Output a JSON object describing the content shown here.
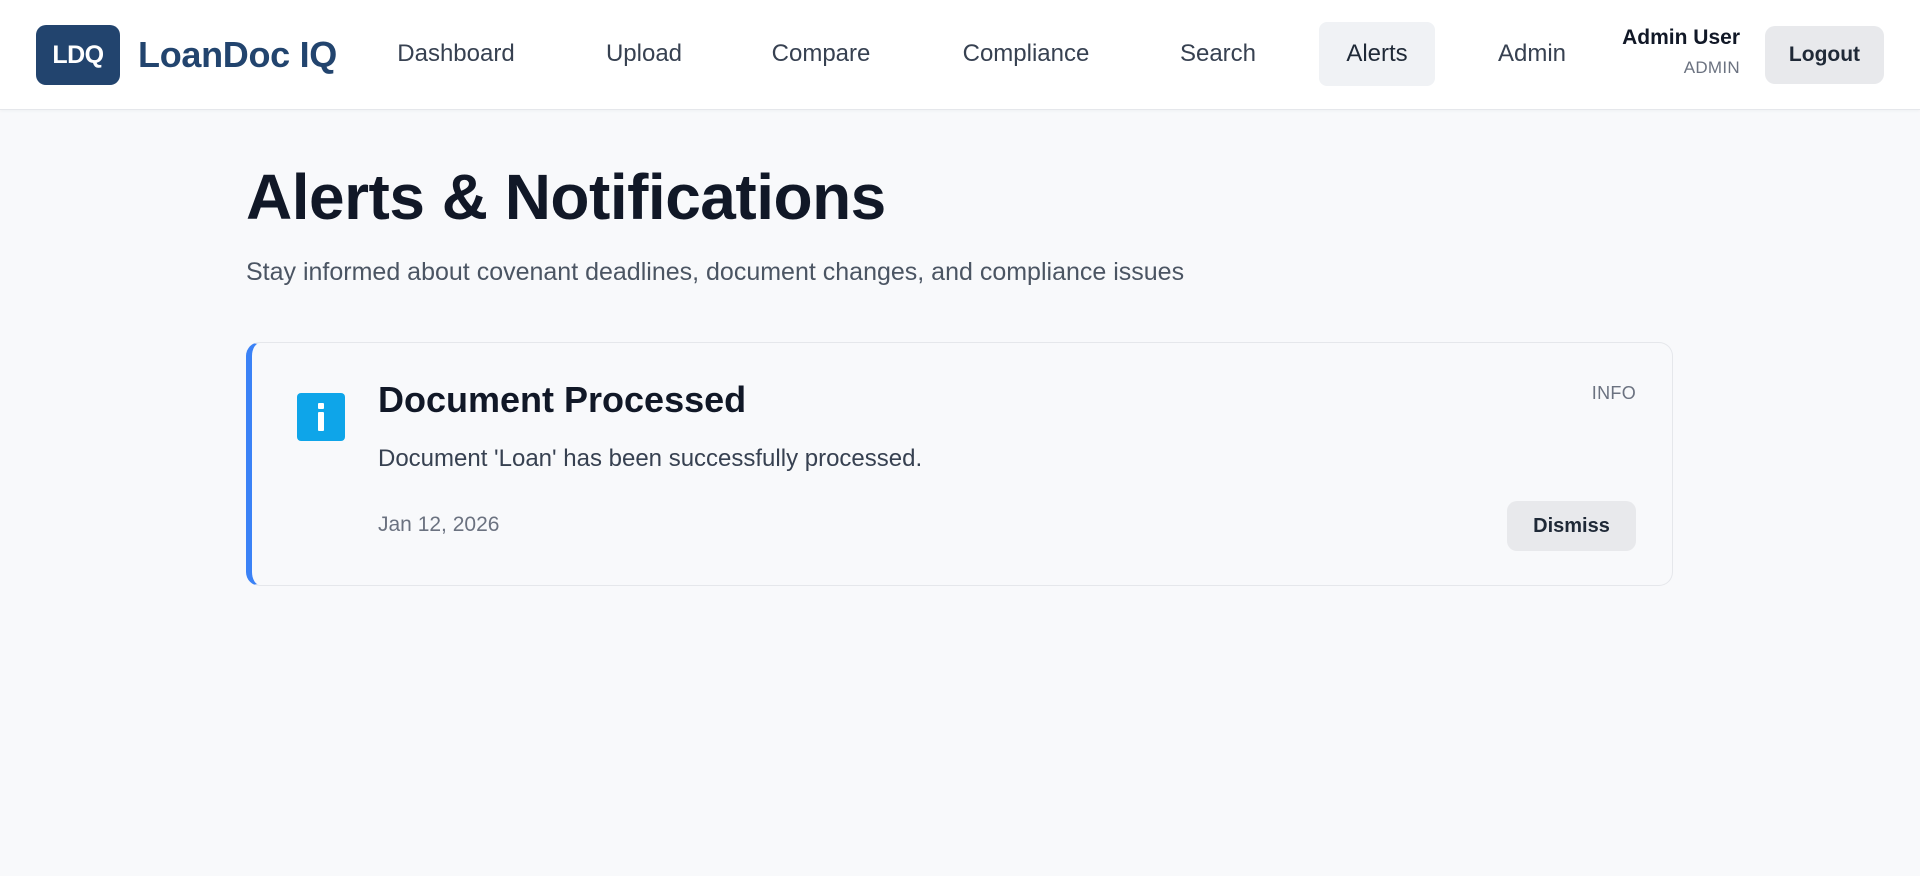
{
  "brand": {
    "logo_text": "LDQ",
    "name": "LoanDoc IQ"
  },
  "nav": {
    "items": [
      {
        "label": "Dashboard",
        "active": false
      },
      {
        "label": "Upload",
        "active": false
      },
      {
        "label": "Compare",
        "active": false
      },
      {
        "label": "Compliance",
        "active": false
      },
      {
        "label": "Search",
        "active": false
      },
      {
        "label": "Alerts",
        "active": true
      },
      {
        "label": "Admin",
        "active": false
      }
    ]
  },
  "user": {
    "name": "Admin User",
    "role": "ADMIN",
    "logout_label": "Logout"
  },
  "page": {
    "title": "Alerts & Notifications",
    "subtitle": "Stay informed about covenant deadlines, document changes, and compliance issues"
  },
  "alerts": [
    {
      "icon": "info-icon",
      "title": "Document Processed",
      "severity": "INFO",
      "message": "Document 'Loan' has been successfully processed.",
      "date": "Jan 12, 2026",
      "dismiss_label": "Dismiss"
    }
  ],
  "colors": {
    "brand": "#22446e",
    "accent": "#3b82f6",
    "info": "#0ea5e9"
  }
}
